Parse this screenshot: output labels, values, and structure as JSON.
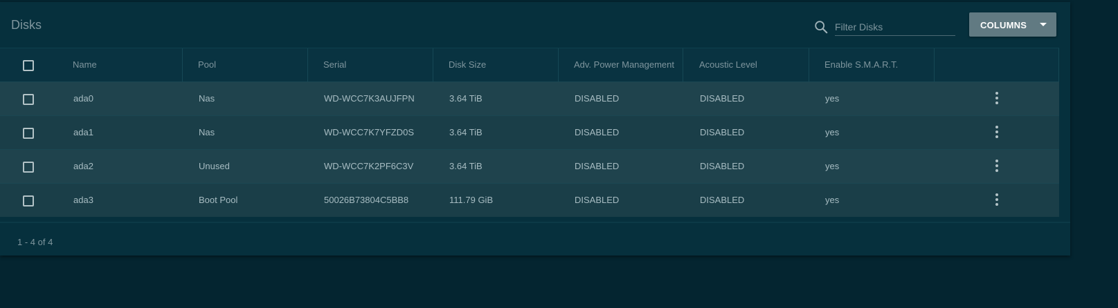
{
  "card": {
    "title": "Disks"
  },
  "toolbar": {
    "search_placeholder": "Filter Disks",
    "search_value": "",
    "columns_label": "COLUMNS"
  },
  "table": {
    "headers": [
      "Name",
      "Pool",
      "Serial",
      "Disk Size",
      "Adv. Power Management",
      "Acoustic Level",
      "Enable S.M.A.R.T."
    ],
    "rows": [
      {
        "name": "ada0",
        "pool": "Nas",
        "serial": "WD-WCC7K3AUJFPN",
        "size": "3.64 TiB",
        "apm": "DISABLED",
        "acoustic": "DISABLED",
        "smart": "yes",
        "selected": false
      },
      {
        "name": "ada1",
        "pool": "Nas",
        "serial": "WD-WCC7K7YFZD0S",
        "size": "3.64 TiB",
        "apm": "DISABLED",
        "acoustic": "DISABLED",
        "smart": "yes",
        "selected": false
      },
      {
        "name": "ada2",
        "pool": "Unused",
        "serial": "WD-WCC7K2PF6C3V",
        "size": "3.64 TiB",
        "apm": "DISABLED",
        "acoustic": "DISABLED",
        "smart": "yes",
        "selected": false
      },
      {
        "name": "ada3",
        "pool": "Boot Pool",
        "serial": "50026B73804C5BB8",
        "size": "111.79 GiB",
        "apm": "DISABLED",
        "acoustic": "DISABLED",
        "smart": "yes",
        "selected": false
      }
    ],
    "select_all": false,
    "row_actions_icon": "more-vertical-icon"
  },
  "footer": {
    "range": "1 - 4 of 4"
  },
  "icons": {
    "search": "search-icon",
    "dropdown": "caret-down-icon",
    "row_menu": "more-vertical-icon"
  },
  "colors": {
    "page_background": "#042530",
    "card_background": "#06303d",
    "header_row": "#093341",
    "row_odd": "#1f434d",
    "row_even": "#1a3e48",
    "button": "#617a82",
    "text": "#a7bcc2",
    "muted_text": "#7e959d"
  }
}
